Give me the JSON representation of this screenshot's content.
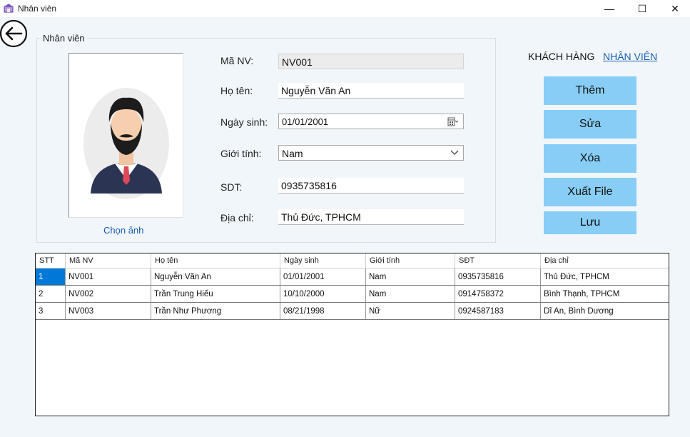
{
  "window": {
    "title": "Nhân viên",
    "min_glyph": "—",
    "max_glyph": "☐",
    "close_glyph": "✕"
  },
  "groupbox": {
    "title": "Nhân viên"
  },
  "photo": {
    "choose_label": "Chọn ảnh"
  },
  "form": {
    "ma_nv": {
      "label": "Mã NV:",
      "value": "NV001"
    },
    "ho_ten": {
      "label": "Họ tên:",
      "value": "Nguyễn Văn An"
    },
    "ngay_sinh": {
      "label": "Ngày sinh:",
      "value": "01/01/2001"
    },
    "gioi_tinh": {
      "label": "Giới tính:",
      "value": "Nam"
    },
    "sdt": {
      "label": "SDT:",
      "value": "0935735816"
    },
    "dia_chi": {
      "label": "Địa chỉ:",
      "value": "Thủ Đức, TPHCM"
    }
  },
  "nav": {
    "customer": "KHÁCH HÀNG",
    "employee": "NHÂN VIÊN"
  },
  "buttons": {
    "add": "Thêm",
    "edit": "Sửa",
    "delete": "Xóa",
    "export": "Xuất File",
    "save": "Lưu"
  },
  "table": {
    "headers": [
      "STT",
      "Mã NV",
      "Họ tên",
      "Ngày sinh",
      "Giới tính",
      "SĐT",
      "Địa chỉ"
    ],
    "rows": [
      [
        "1",
        "NV001",
        "Nguyễn Văn An",
        "01/01/2001",
        "Nam",
        "0935735816",
        "Thủ Đức, TPHCM"
      ],
      [
        "2",
        "NV002",
        "Trần Trung Hiếu",
        "10/10/2000",
        "Nam",
        "0914758372",
        "Bình Thạnh, TPHCM"
      ],
      [
        "3",
        "NV003",
        "Trần Như Phương",
        "08/21/1998",
        "Nữ",
        "0924587183",
        "Dĩ An, Bình Dương"
      ]
    ]
  },
  "colors": {
    "button_bg": "#87cdf6",
    "selection": "#0078d7",
    "link": "#1a5fb4"
  },
  "icons": {
    "app": "app-icon",
    "back": "back-arrow-icon",
    "calendar": "calendar-icon",
    "dropdown": "chevron-down-icon",
    "avatar": "person-avatar-icon"
  }
}
